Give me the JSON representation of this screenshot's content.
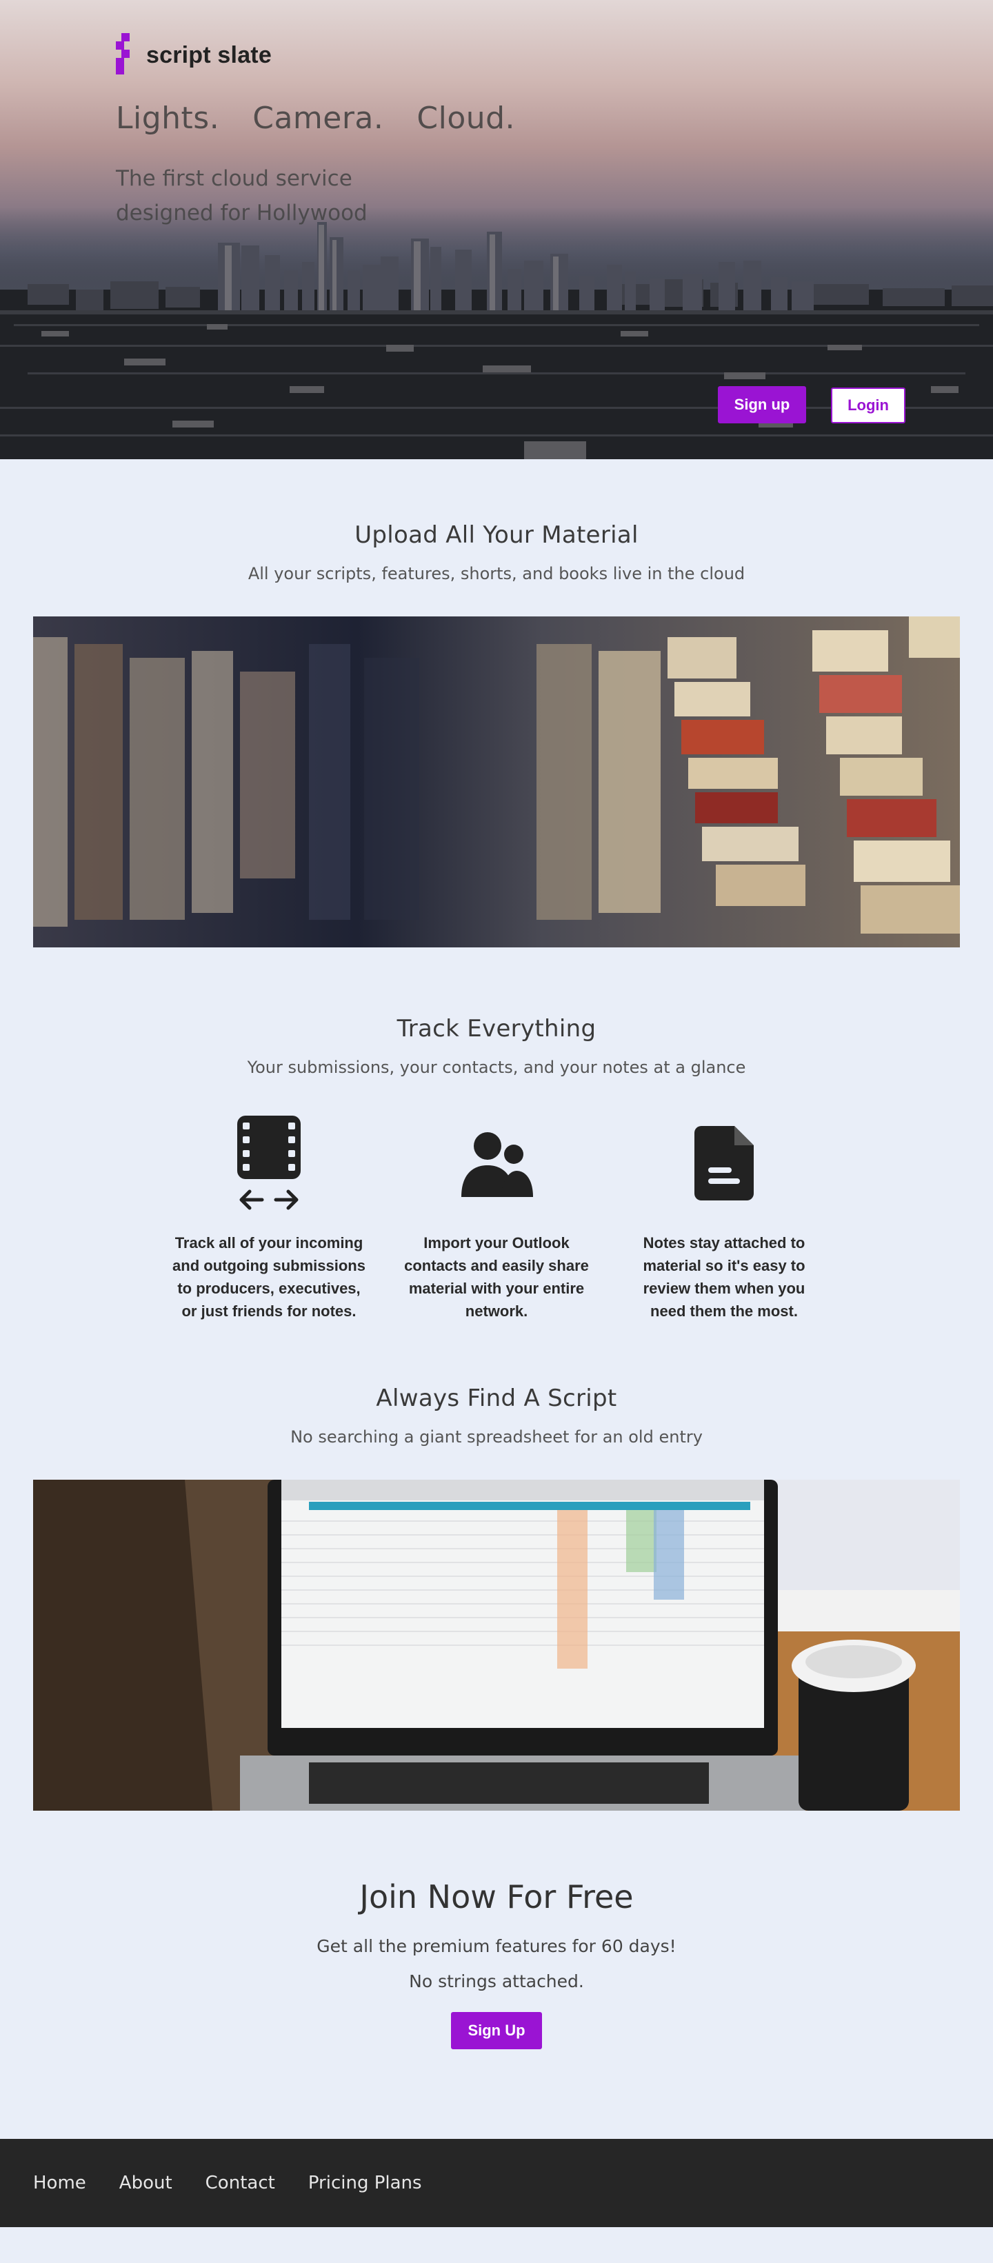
{
  "brand": {
    "name": "script slate",
    "color": "#9a14d3"
  },
  "hero": {
    "tagline": [
      "Lights.",
      "Camera.",
      "Cloud."
    ],
    "subtitle": "The first cloud service designed for Hollywood",
    "signup_label": "Sign up",
    "login_label": "Login"
  },
  "upload": {
    "title": "Upload All Your Material",
    "subtitle": "All your scripts, features, shorts, and books live in the cloud"
  },
  "track": {
    "title": "Track Everything",
    "subtitle": "Your submissions, your contacts, and your notes at a glance",
    "features": [
      {
        "icon": "film-exchange-icon",
        "text": "Track all of your incoming and outgoing submissions to producers, executives, or just friends for notes."
      },
      {
        "icon": "users-icon",
        "text": "Import your Outlook contacts and easily share material with your entire network."
      },
      {
        "icon": "document-icon",
        "text": "Notes stay attached to material so it's easy to review them when you need them the most."
      }
    ]
  },
  "find": {
    "title": "Always Find A Script",
    "subtitle": "No searching a giant spreadsheet for an old entry"
  },
  "join": {
    "title": "Join Now For Free",
    "line1": "Get all the premium features for 60 days!",
    "line2": "No strings attached.",
    "signup_label": "Sign Up"
  },
  "footer": {
    "links": [
      "Home",
      "About",
      "Contact",
      "Pricing Plans"
    ]
  }
}
